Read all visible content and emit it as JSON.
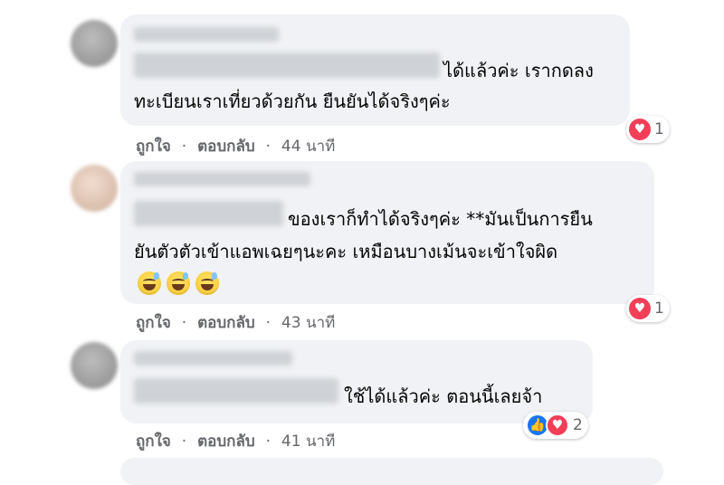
{
  "actions": {
    "like": "ถูกใจ",
    "reply": "ตอบกลับ",
    "sep": "·"
  },
  "comments": [
    {
      "lines": [
        "ได้แล้วค่ะ เรากดลง",
        "ทะเบียนเราเที่ยวด้วยกัน ยืนยันได้จริงๆค่ะ"
      ],
      "time": "44 นาที",
      "reaction_count": "1",
      "reactions": [
        "love-icon"
      ]
    },
    {
      "lines": [
        "ของเราก็ทำได้จริงๆค่ะ **มันเป็นการยืน",
        "ยันตัวตัวเข้าแอพเฉยๆนะคะ เหมือนบางเม้นจะเข้าใจผิด"
      ],
      "emojis": [
        "sweat-smile-emoji",
        "sweat-smile-emoji",
        "sweat-smile-emoji"
      ],
      "time": "43 นาที",
      "reaction_count": "1",
      "reactions": [
        "love-icon"
      ]
    },
    {
      "lines": [
        "ใช้ได้แล้วค่ะ ตอนนี้เลยจ้า"
      ],
      "time": "41 นาที",
      "reaction_count": "2",
      "reactions": [
        "like-icon",
        "love-icon"
      ]
    }
  ],
  "colors": {
    "bubble": "#f0f2f5",
    "meta": "#65676b",
    "love": "#f33e58",
    "like": "#1877f2"
  }
}
